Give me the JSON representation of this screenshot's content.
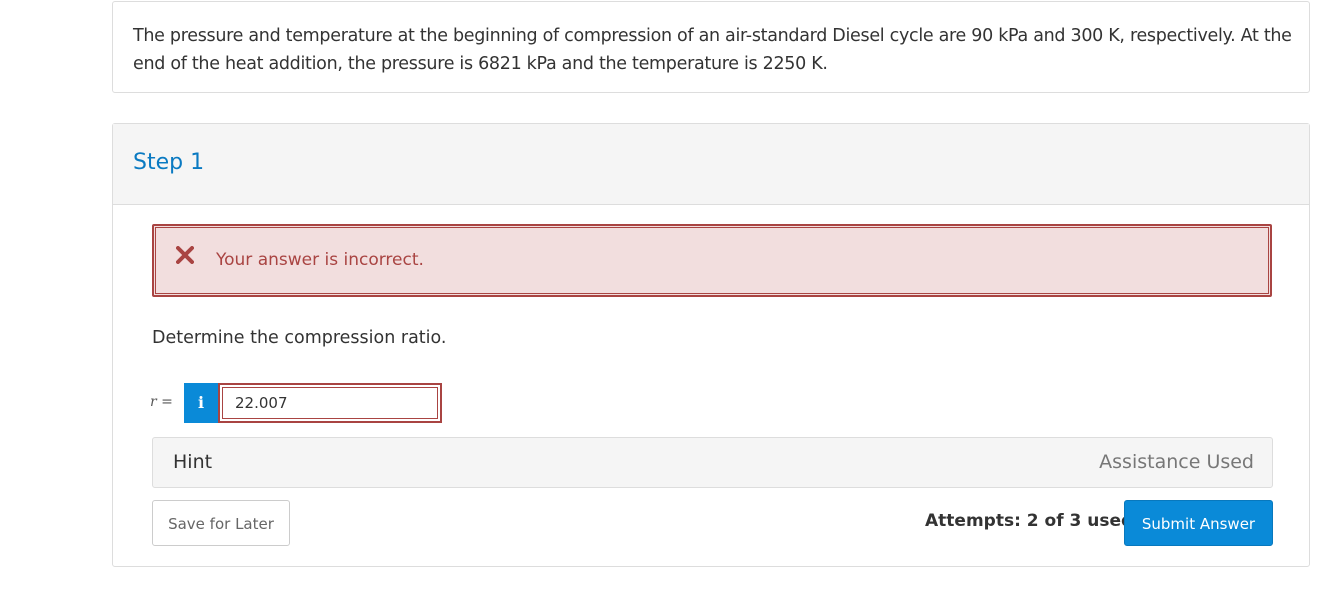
{
  "question": {
    "text": "The pressure and temperature at the beginning of compression of an air-standard Diesel cycle are 90 kPa and 300 K, respectively. At the end of the heat addition, the pressure is 6821 kPa and the temperature is 2250 K."
  },
  "step": {
    "title": "Step 1",
    "alert": {
      "icon": "close-x-icon",
      "message": "Your answer is incorrect.",
      "color": "#a94442"
    },
    "prompt": "Determine the compression ratio.",
    "variable_label": "r =",
    "info_icon_glyph": "i",
    "answer_value": "22.007",
    "hint_label": "Hint",
    "assistance_label": "Assistance Used",
    "save_label": "Save for Later",
    "attempts_text": "Attempts: 2 of 3 used",
    "submit_label": "Submit Answer"
  },
  "colors": {
    "accent": "#0a8ad8",
    "step_title": "#0a7ac2",
    "error": "#a94442",
    "error_bg": "#f2dede"
  }
}
